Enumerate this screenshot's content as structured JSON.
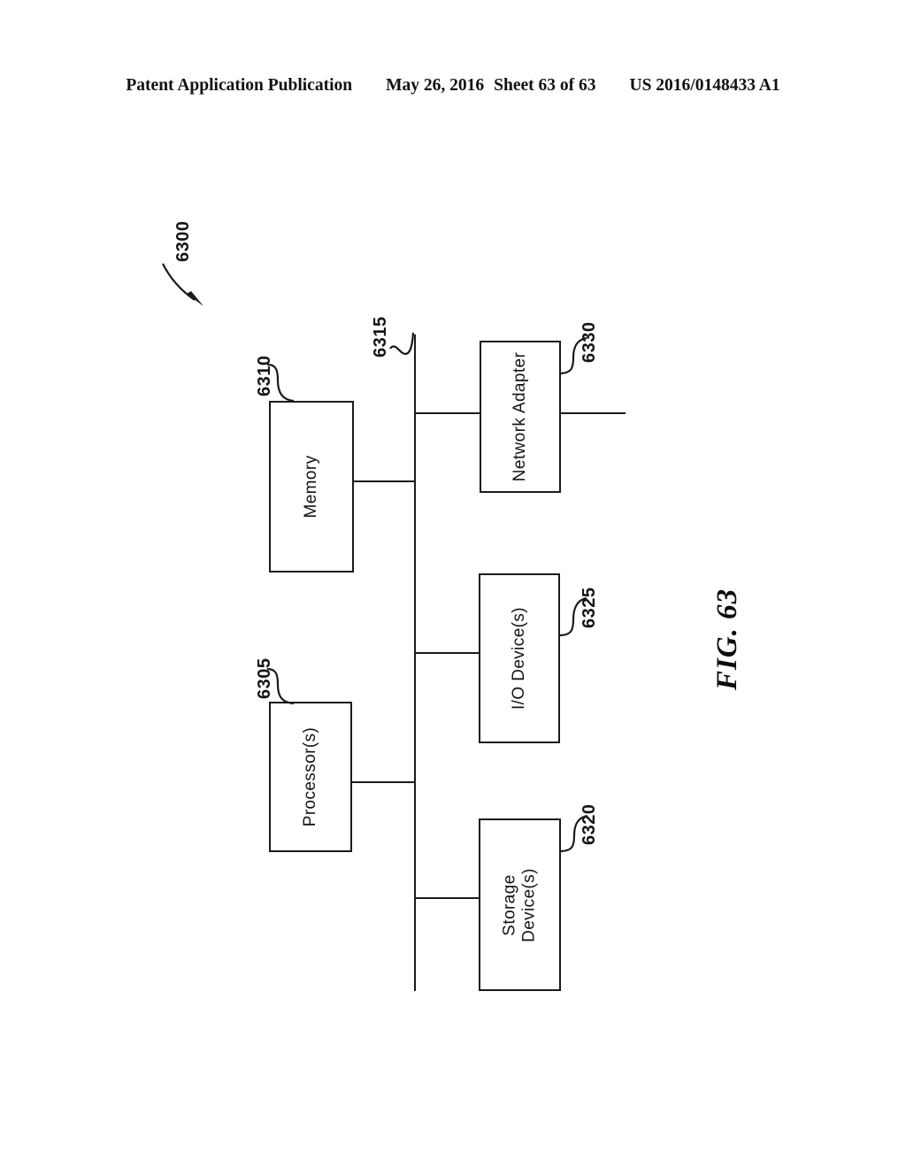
{
  "header": {
    "publication": "Patent Application Publication",
    "date": "May 26, 2016",
    "sheet": "Sheet 63 of 63",
    "patent_number": "US 2016/0148433 A1"
  },
  "figure": {
    "caption": "FIG. 63",
    "system_numeral": "6300",
    "bus_numeral": "6315",
    "blocks": [
      {
        "id": "processor",
        "label": "Processor(s)",
        "numeral": "6305"
      },
      {
        "id": "memory",
        "label": "Memory",
        "numeral": "6310"
      },
      {
        "id": "storage-devices",
        "label": "Storage\nDevice(s)",
        "numeral": "6320"
      },
      {
        "id": "io-devices",
        "label": "I/O Device(s)",
        "numeral": "6325"
      },
      {
        "id": "network-adapter",
        "label": "Network Adapter",
        "numeral": "6330"
      }
    ]
  },
  "colors": {
    "ink": "#1a1a1a",
    "paper": "#ffffff"
  }
}
